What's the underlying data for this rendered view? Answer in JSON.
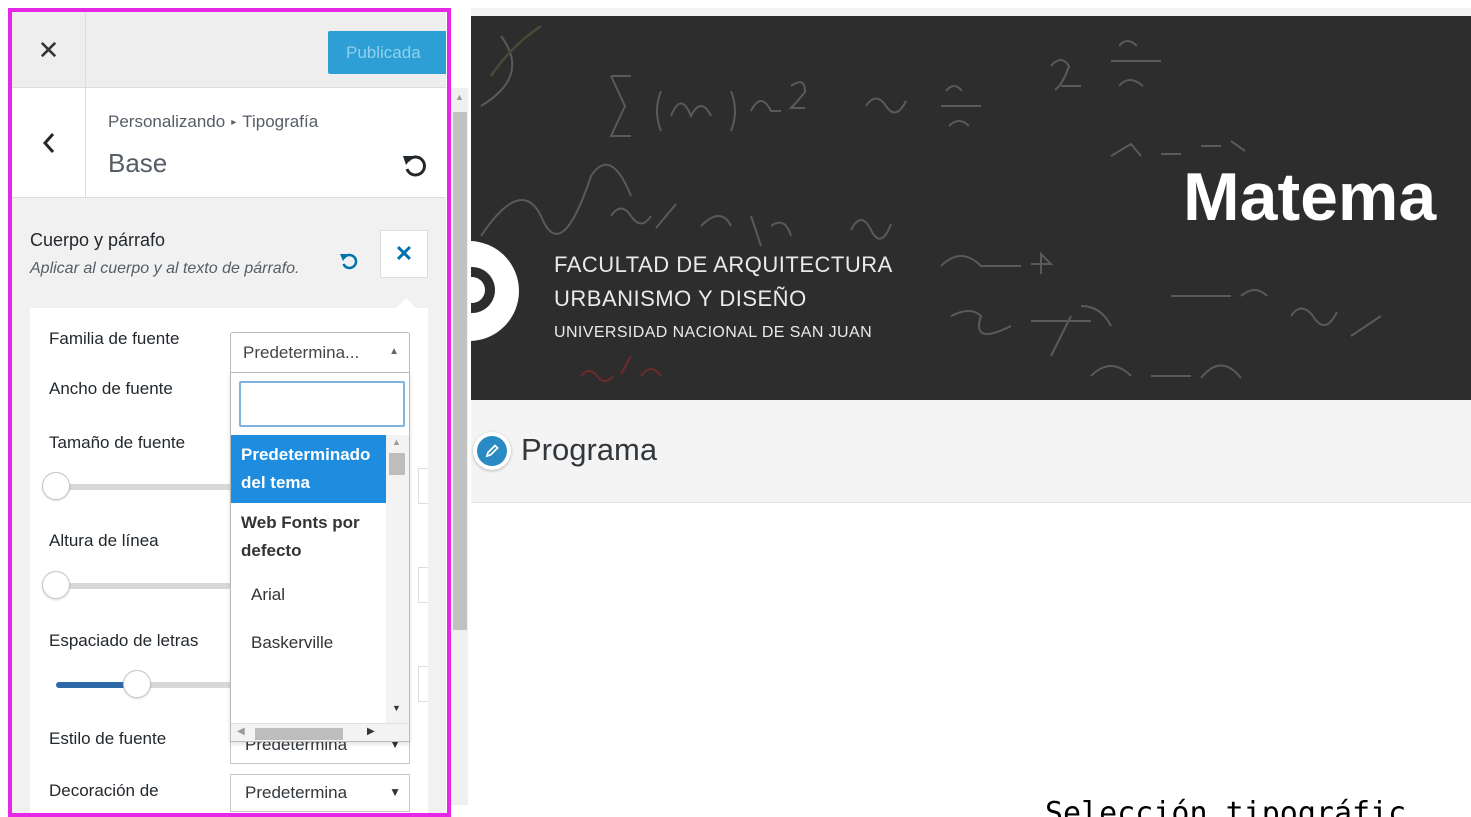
{
  "toolbar": {
    "close_symbol": "✕",
    "publish_label": "Publicada"
  },
  "header": {
    "breadcrumb_root": "Personalizando",
    "breadcrumb_separator": "▸",
    "breadcrumb_current": "Tipografía",
    "title": "Base"
  },
  "field": {
    "label": "Cuerpo y párrafo",
    "description": "Aplicar al cuerpo y al texto de párrafo.",
    "close_symbol": "✕"
  },
  "typography": {
    "family_label": "Familia de fuente",
    "family_value": "Predetermina...",
    "weight_label": "Ancho de fuente",
    "size_label": "Tamaño de fuente",
    "line_height_label": "Altura de línea",
    "letter_spacing_label": "Espaciado de letras",
    "style_label": "Estilo de fuente",
    "style_value": "Predetermina",
    "decoration_label": "Decoración de",
    "decoration_value": "Predetermina",
    "size_slider_level": 0,
    "line_height_slider_level": 0,
    "letter_spacing_slider_level": 0.45
  },
  "dropdown": {
    "search_value": "",
    "selected_option": "Predeterminado del tema",
    "group_label": "Web Fonts por defecto",
    "options": [
      "Arial",
      "Baskerville"
    ]
  },
  "preview": {
    "faculty_line1": "FACULTAD DE ARQUITECTURA",
    "faculty_line2": "URBANISMO Y DISEÑO",
    "university": "UNIVERSIDAD NACIONAL DE SAN JUAN",
    "site_title": "Matema",
    "menu_item": "Programa"
  },
  "caption": "Selección tipográfic",
  "colors": {
    "highlight": "#e628e6",
    "accent": "#2e9fd4",
    "selected_option": "#1e8cdf",
    "banner_bg": "#2d2d2d"
  },
  "icons": {
    "close": "close-icon",
    "back": "chevron-left-icon",
    "reset": "undo-icon",
    "edit": "pencil-icon"
  }
}
